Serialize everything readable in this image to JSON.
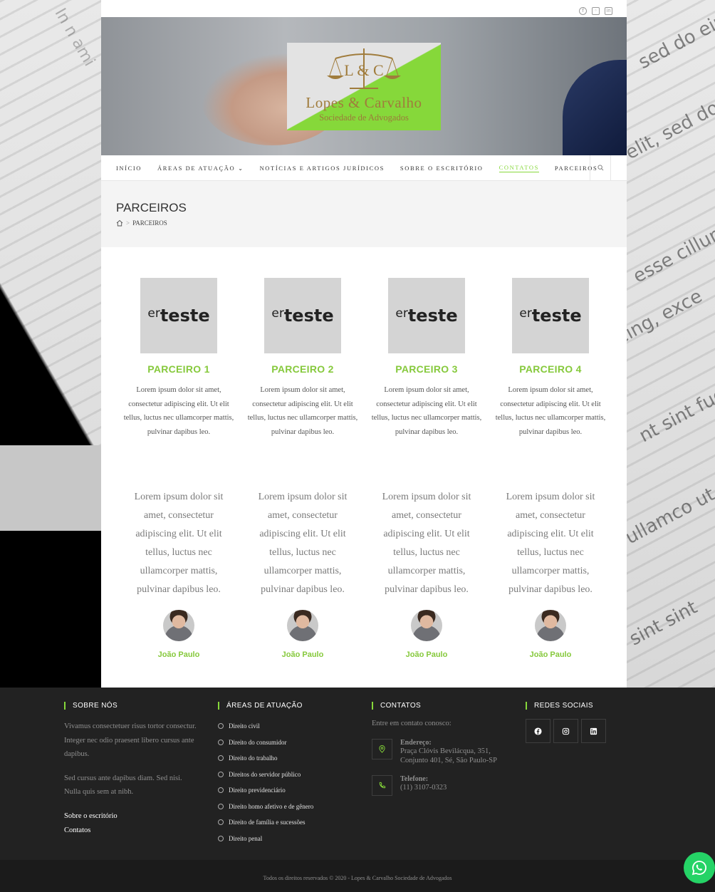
{
  "header": {
    "social_top": [
      "facebook-icon",
      "instagram-icon",
      "linkedin-icon"
    ],
    "logo": {
      "initials": "L & C",
      "name": "Lopes & Carvalho",
      "subtitle": "Sociedade de Advogados"
    }
  },
  "nav": {
    "items": [
      {
        "label": "INÍCIO"
      },
      {
        "label": "ÁREAS DE ATUAÇÃO",
        "caret": "⌄"
      },
      {
        "label": "NOTÍCIAS E ARTIGOS JURÍDICOS"
      },
      {
        "label": "SOBRE O ESCRITÓRIO"
      },
      {
        "label": "CONTATOS",
        "active": true
      },
      {
        "label": "PARCEIROS"
      }
    ]
  },
  "title_band": {
    "title": "PARCEIROS",
    "breadcrumb_sep": ">",
    "breadcrumb_current": "PARCEIROS"
  },
  "partners": [
    {
      "img_small": "er",
      "img_big": "teste",
      "name": "PARCEIRO 1",
      "desc": "Lorem ipsum dolor sit amet, consectetur adipiscing elit. Ut elit tellus, luctus nec ullamcorper mattis, pulvinar dapibus leo."
    },
    {
      "img_small": "er",
      "img_big": "teste",
      "name": "PARCEIRO 2",
      "desc": "Lorem ipsum dolor sit amet, consectetur adipiscing elit. Ut elit tellus, luctus nec ullamcorper mattis, pulvinar dapibus leo."
    },
    {
      "img_small": "er",
      "img_big": "teste",
      "name": "PARCEIRO 3",
      "desc": "Lorem ipsum dolor sit amet, consectetur adipiscing elit. Ut elit tellus, luctus nec ullamcorper mattis, pulvinar dapibus leo."
    },
    {
      "img_small": "er",
      "img_big": "teste",
      "name": "PARCEIRO 4",
      "desc": "Lorem ipsum dolor sit amet, consectetur adipiscing elit. Ut elit tellus, luctus nec ullamcorper mattis, pulvinar dapibus leo."
    }
  ],
  "testimonials": [
    {
      "text": "Lorem ipsum dolor sit amet, consectetur adipiscing elit. Ut elit tellus, luctus nec ullamcorper mattis, pulvinar dapibus leo.",
      "name": "João Paulo"
    },
    {
      "text": "Lorem ipsum dolor sit amet, consectetur adipiscing elit. Ut elit tellus, luctus nec ullamcorper mattis, pulvinar dapibus leo.",
      "name": "João Paulo"
    },
    {
      "text": "Lorem ipsum dolor sit amet, consectetur adipiscing elit. Ut elit tellus, luctus nec ullamcorper mattis, pulvinar dapibus leo.",
      "name": "João Paulo"
    },
    {
      "text": "Lorem ipsum dolor sit amet, consectetur adipiscing elit. Ut elit tellus, luctus nec ullamcorper mattis, pulvinar dapibus leo.",
      "name": "João Paulo"
    }
  ],
  "footer": {
    "about": {
      "heading": "SOBRE NÓS",
      "p1": "Vivamus consectetuer risus tortor consectur. Integer nec odio praesent libero cursus ante dapibus.",
      "p2": "Sed cursus ante dapibus diam. Sed nisi. Nulla quis sem at nibh.",
      "links": [
        "Sobre o escritório",
        "Contatos"
      ]
    },
    "areas": {
      "heading": "ÁREAS DE ATUAÇÃO",
      "items": [
        "Direito civil",
        "Direito do consumidor",
        "Direito do trabalho",
        "Direitos do servidor público",
        "Direito previdenciário",
        "Direito homo afetivo e de gênero",
        "Direito de família e sucessões",
        "Direito penal"
      ]
    },
    "contacts": {
      "heading": "CONTATOS",
      "intro": "Entre em contato conosco:",
      "address_label": "Endereço:",
      "address": "Praça Clóvis Bevilácqua, 351, Conjunto 401, Sé, São Paulo-SP",
      "phone_label": "Telefone:",
      "phone": "(11) 3107-0323"
    },
    "social": {
      "heading": "REDES SOCIAIS",
      "icons": [
        "facebook-icon",
        "instagram-icon",
        "linkedin-icon"
      ]
    },
    "copyright": "Todos os direitos reservados © 2020 - Lopes & Carvalho Sociedade de Advogados"
  },
  "colors": {
    "accent": "#86d83a",
    "footer_bg": "#222222",
    "whatsapp": "#25d366"
  }
}
